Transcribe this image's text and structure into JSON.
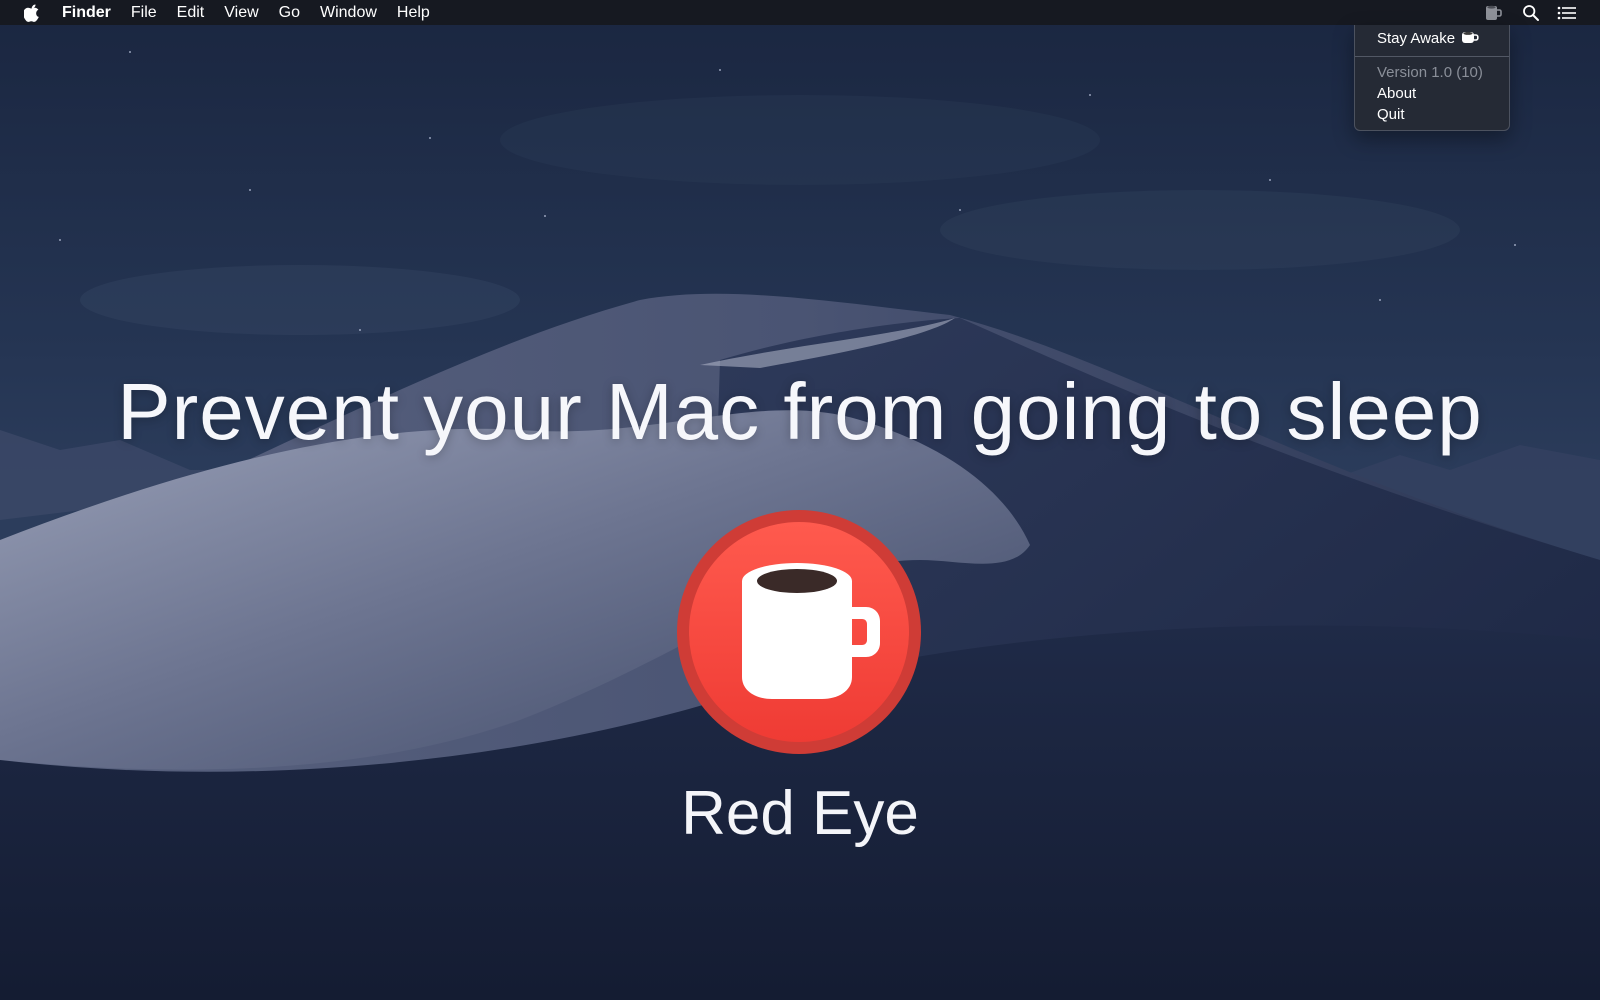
{
  "menubar": {
    "app_name": "Finder",
    "menus": [
      "File",
      "Edit",
      "View",
      "Go",
      "Window",
      "Help"
    ],
    "status_icons": [
      "coffee-cup-status-icon",
      "search-icon",
      "list-icon"
    ]
  },
  "dropdown": {
    "stay_awake": "Stay Awake",
    "version": "Version 1.0 (10)",
    "about": "About",
    "quit": "Quit"
  },
  "headline": "Prevent your Mac from going to sleep",
  "app": {
    "name": "Red Eye",
    "icon": "coffee-mug-icon"
  },
  "colors": {
    "icon_red": "#f0453e",
    "icon_ring": "#cf3c36",
    "sky": "#22324f",
    "dune_light": "#8d93ab"
  }
}
